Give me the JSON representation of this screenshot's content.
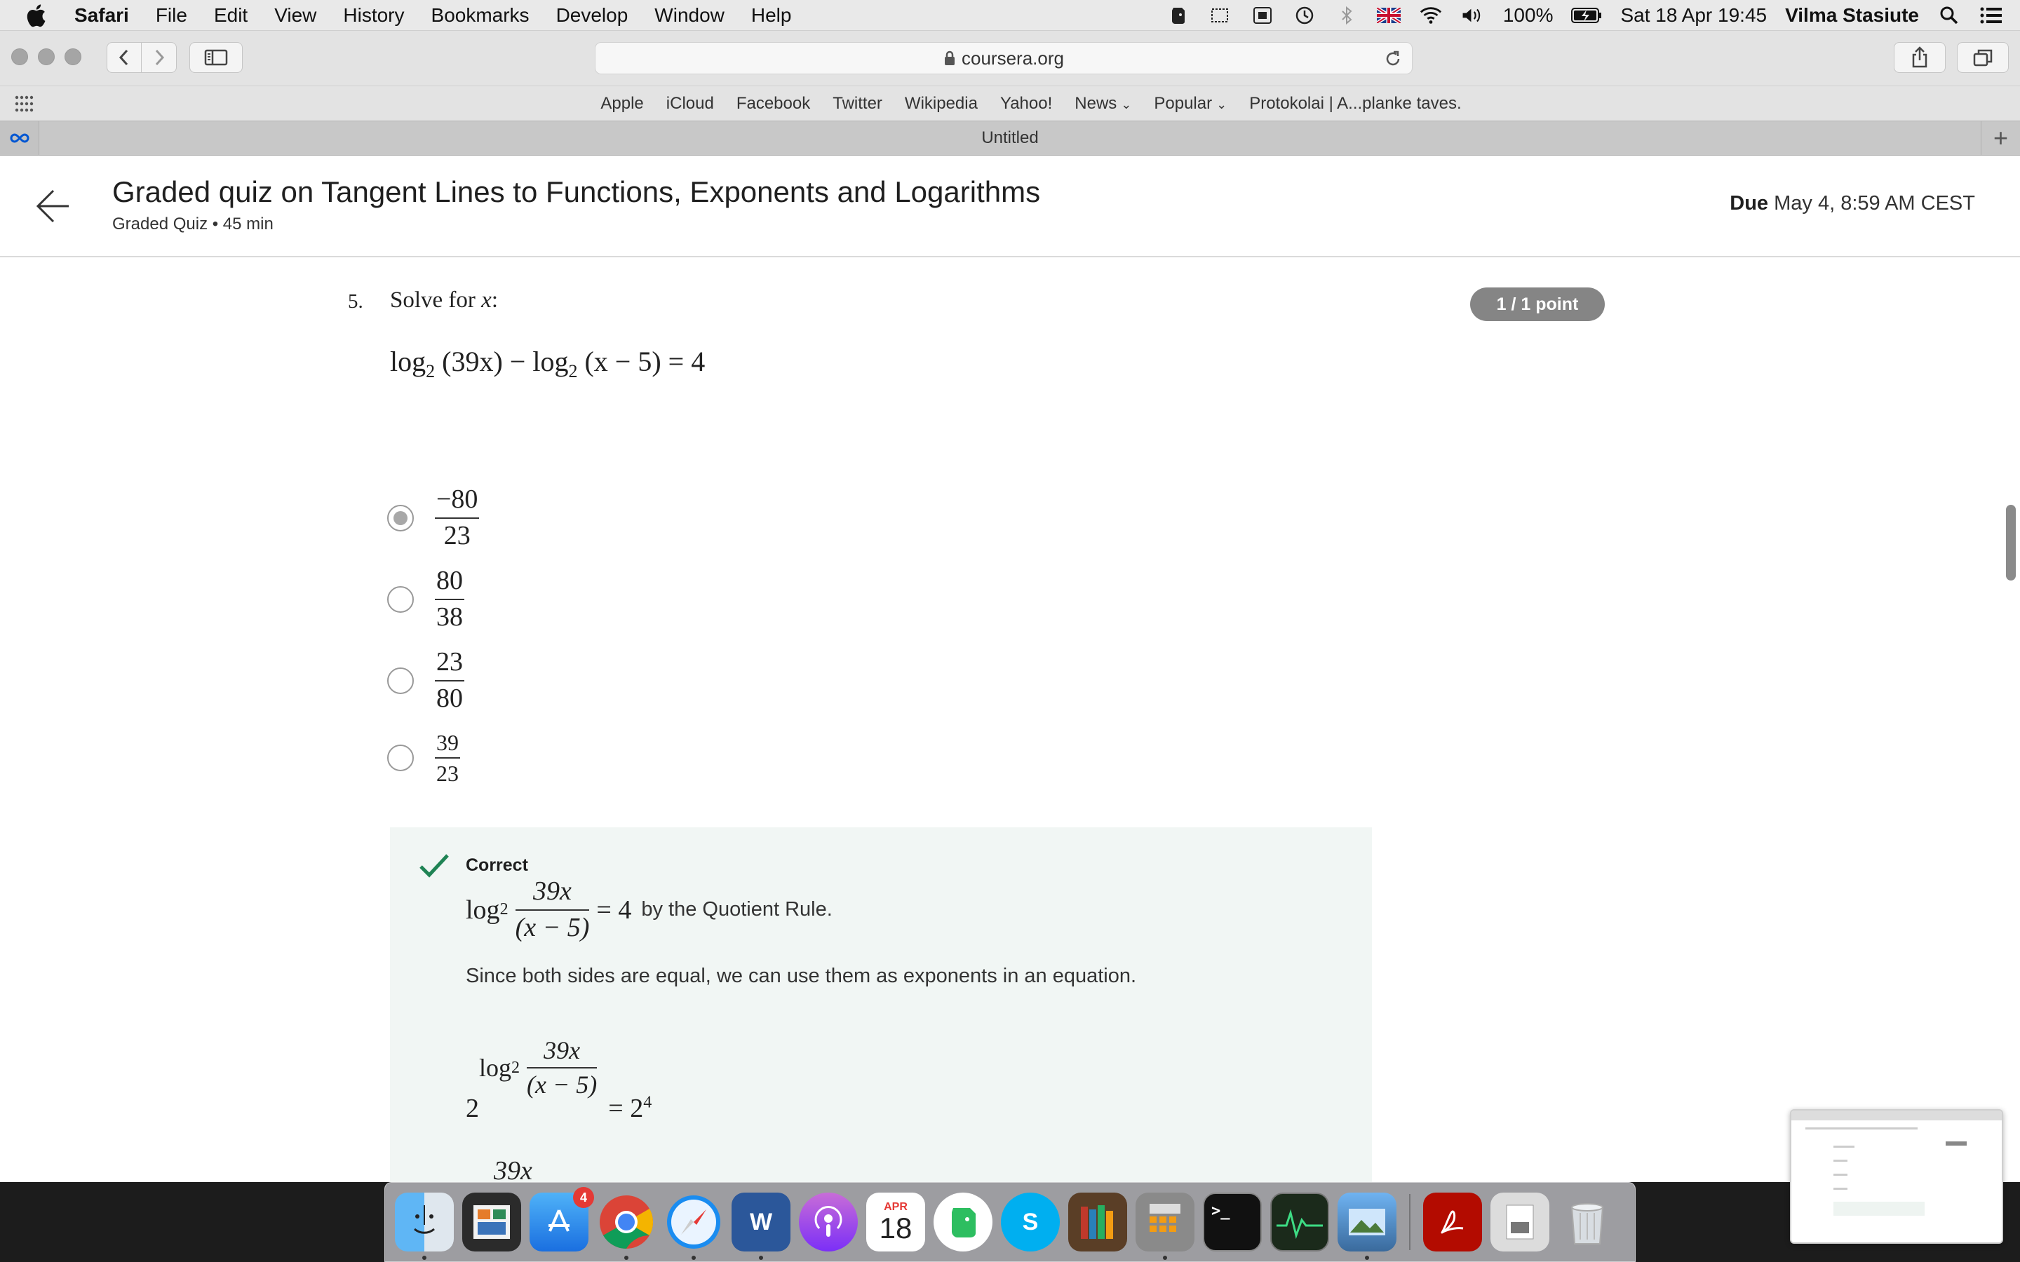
{
  "menubar": {
    "app_name": "Safari",
    "items": [
      "File",
      "Edit",
      "View",
      "History",
      "Bookmarks",
      "Develop",
      "Window",
      "Help"
    ],
    "battery": "100%",
    "datetime": "Sat 18 Apr  19:45",
    "user": "Vilma Stasiute"
  },
  "browser": {
    "url": "coursera.org",
    "favorites": [
      "Apple",
      "iCloud",
      "Facebook",
      "Twitter",
      "Wikipedia",
      "Yahoo!",
      "News",
      "Popular",
      "Protokolai | A...planke taves."
    ],
    "tab_title": "Untitled"
  },
  "header": {
    "title": "Graded quiz on Tangent Lines to Functions, Exponents and Logarithms",
    "subtitle": "Graded Quiz • 45 min",
    "due_label": "Due",
    "due_value": "May 4, 8:59 AM CEST"
  },
  "question": {
    "number": "5.",
    "prompt": "Solve for",
    "prompt_var": "x",
    "points": "1 / 1 point",
    "equation": {
      "log1": "log",
      "base1": "2",
      "arg1": "(39x)",
      "minus": "−",
      "log2": "log",
      "base2": "2",
      "arg2": "(x − 5)",
      "rhs": "= 4"
    },
    "options": [
      {
        "num": "−80",
        "den": "23",
        "selected": true
      },
      {
        "num": "80",
        "den": "38",
        "selected": false
      },
      {
        "num": "23",
        "den": "80",
        "selected": false
      },
      {
        "num": "39",
        "den": "23",
        "selected": false
      }
    ]
  },
  "feedback": {
    "status": "Correct",
    "row1": {
      "log": "log",
      "base": "2",
      "num": "39x",
      "den": "(x − 5)",
      "rhs": "= 4",
      "text": "by the Quotient Rule."
    },
    "paragraph": "Since both sides are equal, we can use them as exponents in an equation.",
    "row2": {
      "base": "2",
      "log": "log",
      "logbase": "2",
      "num": "39x",
      "den": "(x − 5)",
      "rhs": "= 2",
      "rhs_exp": "4"
    },
    "row3_partial": "39x"
  },
  "dock": {
    "appstore_badge": "4",
    "calendar_month": "APR",
    "calendar_day": "18"
  },
  "colors": {
    "feedback_bg": "#f1f6f4",
    "check_green": "#1f8354",
    "points_pill": "#858585"
  }
}
